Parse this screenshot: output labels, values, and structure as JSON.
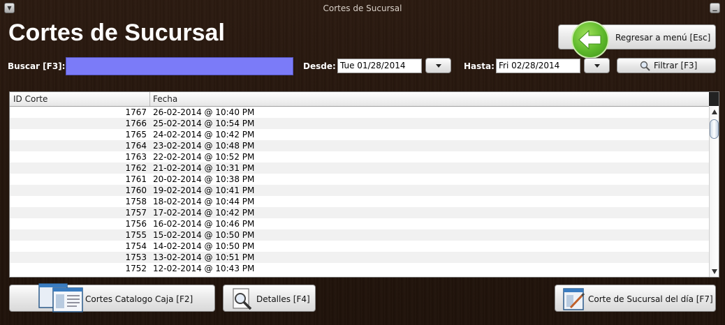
{
  "window": {
    "title": "Cortes de Sucursal"
  },
  "header": {
    "title": "Cortes de Sucursal",
    "back_button": "Regresar a menú [Esc]"
  },
  "filters": {
    "search_label": "Buscar [F3]:",
    "search_value": "",
    "from_label": "Desde:",
    "from_value": "Tue 01/28/2014",
    "to_label": "Hasta:",
    "to_value": "Fri 02/28/2014",
    "filter_button": "Filtrar [F3]"
  },
  "table": {
    "columns": [
      "ID Corte",
      "Fecha"
    ],
    "rows": [
      [
        "1767",
        "26-02-2014 @ 10:40 PM"
      ],
      [
        "1766",
        "25-02-2014 @ 10:54 PM"
      ],
      [
        "1765",
        "24-02-2014 @ 10:42 PM"
      ],
      [
        "1764",
        "23-02-2014 @ 10:48 PM"
      ],
      [
        "1763",
        "22-02-2014 @ 10:52 PM"
      ],
      [
        "1762",
        "21-02-2014 @ 10:31 PM"
      ],
      [
        "1761",
        "20-02-2014 @ 10:38 PM"
      ],
      [
        "1760",
        "19-02-2014 @ 10:41 PM"
      ],
      [
        "1758",
        "18-02-2014 @ 10:44 PM"
      ],
      [
        "1757",
        "17-02-2014 @ 10:42 PM"
      ],
      [
        "1756",
        "16-02-2014 @ 10:46 PM"
      ],
      [
        "1755",
        "15-02-2014 @ 10:50 PM"
      ],
      [
        "1754",
        "14-02-2014 @ 10:50 PM"
      ],
      [
        "1753",
        "13-02-2014 @ 10:51 PM"
      ],
      [
        "1752",
        "12-02-2014 @ 10:43 PM"
      ]
    ]
  },
  "actions": {
    "cortes_catalogo": "Cortes Catalogo Caja [F2]",
    "detalles": "Detalles [F4]",
    "corte_dia": "Corte de Sucursal del día [F7]"
  },
  "icons": {
    "back": "green-left-arrow-icon",
    "filter": "magnifier-icon",
    "cortes": "document-stack-icon",
    "detalles": "magnifier-document-icon",
    "corte_dia": "edit-document-icon"
  },
  "colors": {
    "search_field": "#7b7bf8",
    "accent_green": "#5cb82a"
  }
}
